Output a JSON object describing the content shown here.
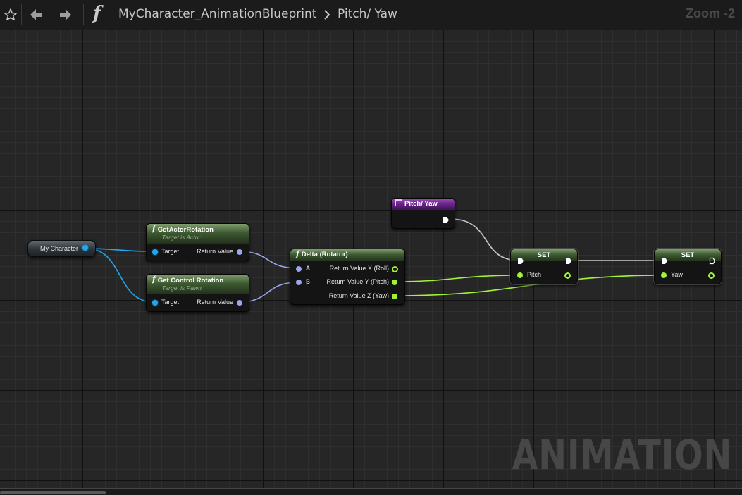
{
  "toolbar": {
    "favorite_icon": "star-outline-icon",
    "back_icon": "arrow-left-icon",
    "forward_icon": "arrow-right-icon",
    "function_icon": "f",
    "breadcrumb": [
      "MyCharacter_AnimationBlueprint",
      "Pitch/ Yaw"
    ],
    "breadcrumb_separator_icon": "chevron-right-icon",
    "zoom": "Zoom -2"
  },
  "graph": {
    "watermark": "ANIMATION",
    "colors": {
      "background": "#262626",
      "object_pin": "#21a7f0",
      "rotator_pin": "#9aa6ef",
      "float_pin": "#a2f23a",
      "exec_wire": "#c8c8c8",
      "function_header": "#4c6b3e",
      "event_header": "#6a2489"
    },
    "nodes": {
      "my_character": {
        "label": "My Character"
      },
      "get_actor_rotation": {
        "title": "GetActorRotation",
        "subtitle": "Target is Actor",
        "in": "Target",
        "out": "Return Value"
      },
      "get_control_rotation": {
        "title": "Get Control Rotation",
        "subtitle": "Target is Pawn",
        "in": "Target",
        "out": "Return Value"
      },
      "delta_rotator": {
        "title": "Delta (Rotator)",
        "in_a": "A",
        "in_b": "B",
        "out_x": "Return Value X (Roll)",
        "out_y": "Return Value Y (Pitch)",
        "out_z": "Return Value Z (Yaw)"
      },
      "pitch_yaw_entry": {
        "title": "Pitch/ Yaw"
      },
      "set_pitch": {
        "title": "SET",
        "pin": "Pitch"
      },
      "set_yaw": {
        "title": "SET",
        "pin": "Yaw"
      }
    }
  }
}
